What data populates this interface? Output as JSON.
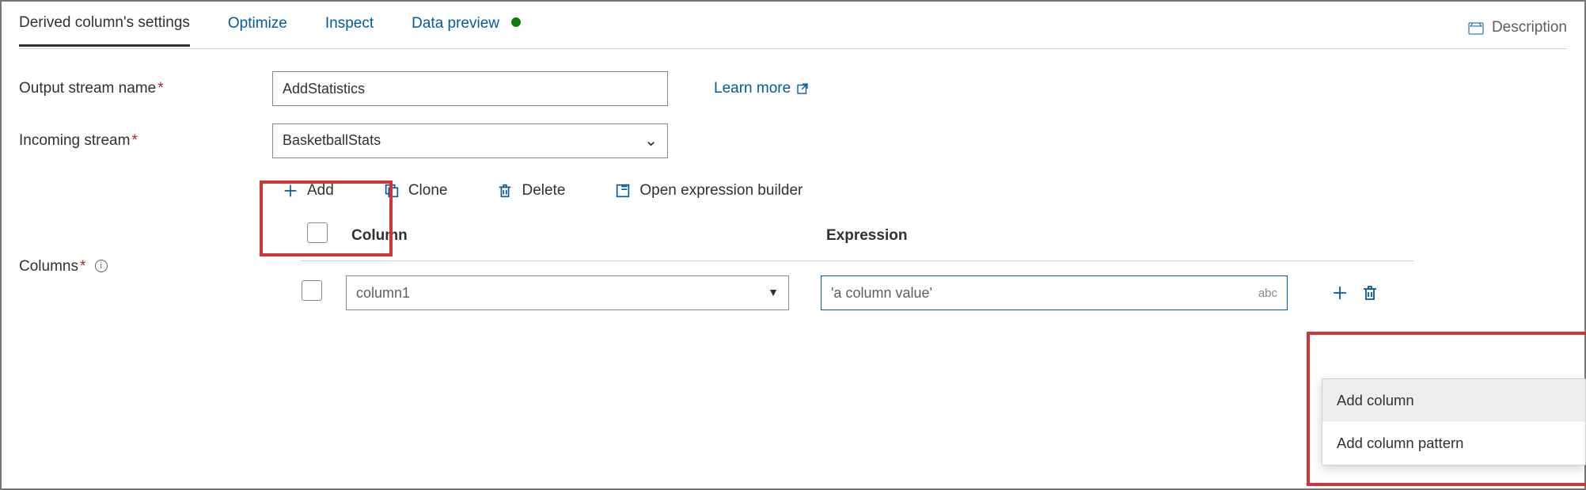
{
  "tabs": {
    "settings": "Derived column's settings",
    "optimize": "Optimize",
    "inspect": "Inspect",
    "preview": "Data preview"
  },
  "description_label": "Description",
  "labels": {
    "output_stream": "Output stream name",
    "incoming_stream": "Incoming stream",
    "columns": "Columns"
  },
  "form": {
    "output_stream_value": "AddStatistics",
    "incoming_stream_value": "BasketballStats",
    "learn_more": "Learn more"
  },
  "toolbar": {
    "add": "Add",
    "clone": "Clone",
    "delete": "Delete",
    "open_builder": "Open expression builder"
  },
  "columns_table": {
    "header_column": "Column",
    "header_expression": "Expression",
    "rows": [
      {
        "column_placeholder": "column1",
        "expression_placeholder": "'a column value'",
        "type_hint": "abc"
      }
    ]
  },
  "context_menu": {
    "add_column": "Add column",
    "add_pattern": "Add column pattern"
  }
}
